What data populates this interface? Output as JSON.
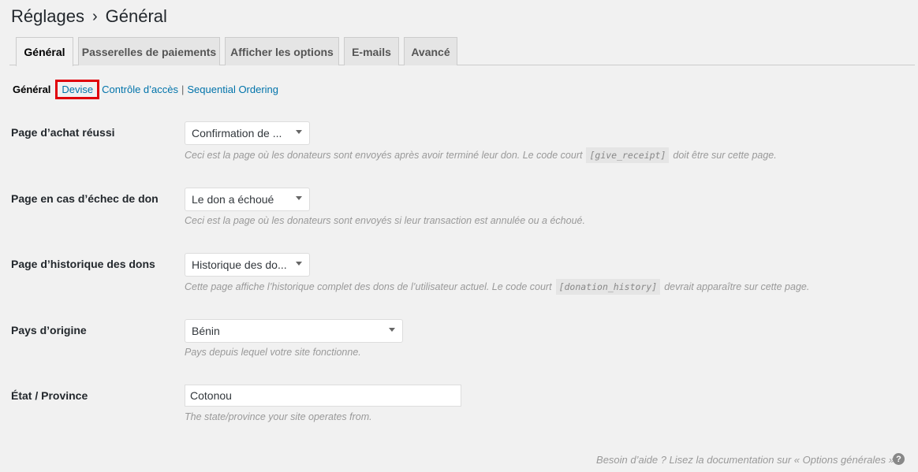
{
  "header": {
    "breadcrumb_root": "Réglages",
    "breadcrumb_separator": "›",
    "breadcrumb_current": "Général"
  },
  "tabs": [
    {
      "label": "Général",
      "active": true
    },
    {
      "label": "Passerelles de paiements",
      "active": false
    },
    {
      "label": "Afficher les options",
      "active": false
    },
    {
      "label": "E-mails",
      "active": false
    },
    {
      "label": "Avancé",
      "active": false
    }
  ],
  "subnav": {
    "current": "Général",
    "links": [
      "Devise",
      "Contrôle d’accès",
      "Sequential Ordering"
    ],
    "separator": "|",
    "highlight_color": "#e0000a"
  },
  "fields": [
    {
      "label": "Page d’achat réussi",
      "value": "Confirmation de ...",
      "desc_before": "Ceci est la page où les donateurs sont envoyés après avoir terminé leur don. Le code court",
      "desc_code": "[give_receipt]",
      "desc_after": "doit être sur cette page."
    },
    {
      "label": "Page en cas d’échec de don",
      "value": "Le don a échoué",
      "desc_before": "Ceci est la page où les donateurs sont envoyés si leur transaction est annulée ou a échoué."
    },
    {
      "label": "Page d’historique des dons",
      "value": "Historique des do...",
      "desc_before": "Cette page affiche l’historique complet des dons de l’utilisateur actuel. Le code court",
      "desc_code": "[donation_history]",
      "desc_after": "devrait apparaître sur cette page."
    },
    {
      "label": "Pays d’origine",
      "value": "Bénin",
      "desc_before": "Pays depuis lequel votre site fonctionne."
    },
    {
      "label": "État / Province",
      "value": "Cotonou",
      "desc_before": "The state/province your site operates from."
    }
  ],
  "footer": {
    "help_text": "Besoin d’aide ? Lisez la documentation sur « Options générales »",
    "help_icon": "?"
  },
  "colors": {
    "link": "#0073aa",
    "background": "#f1f1f1"
  }
}
